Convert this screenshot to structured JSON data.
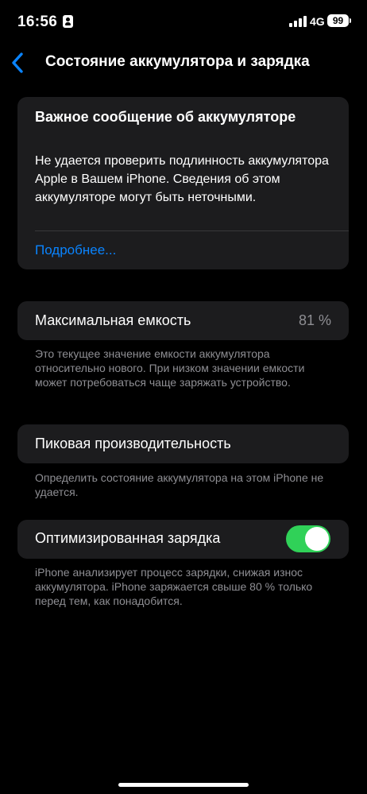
{
  "status_bar": {
    "time": "16:56",
    "network": "4G",
    "battery": "99"
  },
  "nav": {
    "title": "Состояние аккумулятора и зарядка",
    "back_icon": "chevron-left-icon",
    "accent_color": "#0a84ff"
  },
  "alert": {
    "title": "Важное сообщение об аккумуляторе",
    "body": "Не удается проверить подлинность аккумулятора Apple в Вашем iPhone. Сведения об этом аккумуляторе могут быть неточными.",
    "link": "Подробнее..."
  },
  "max_capacity": {
    "label": "Максимальная емкость",
    "value": "81 %",
    "footnote": "Это текущее значение емкости аккумулятора относительно нового. При низком значении емкости может потребоваться чаще заряжать устройство."
  },
  "peak_performance": {
    "label": "Пиковая производительность",
    "footnote": "Определить состояние аккумулятора на этом iPhone не удается."
  },
  "optimized_charging": {
    "label": "Оптимизированная зарядка",
    "enabled": true,
    "toggle_color": "#30d158",
    "footnote": "iPhone анализирует процесс зарядки, снижая износ аккумулятора. iPhone заряжается свыше 80 % только перед тем, как понадобится."
  }
}
